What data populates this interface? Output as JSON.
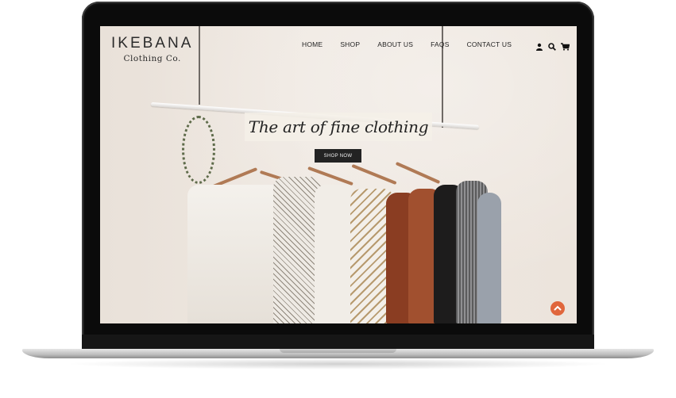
{
  "brand": {
    "name": "IKEBANA",
    "tagline": "Clothing Co."
  },
  "nav": {
    "items": [
      "HOME",
      "SHOP",
      "ABOUT US",
      "FAQS",
      "CONTACT US"
    ]
  },
  "header_icons": [
    "user-icon",
    "search-icon",
    "cart-icon"
  ],
  "hero": {
    "title": "The art of fine clothing",
    "button_label": "SHOP NOW"
  },
  "colors": {
    "accent": "#e0663c",
    "button_bg": "#232323",
    "text": "#222222"
  },
  "scroll_top_icon": "chevron-up-icon"
}
